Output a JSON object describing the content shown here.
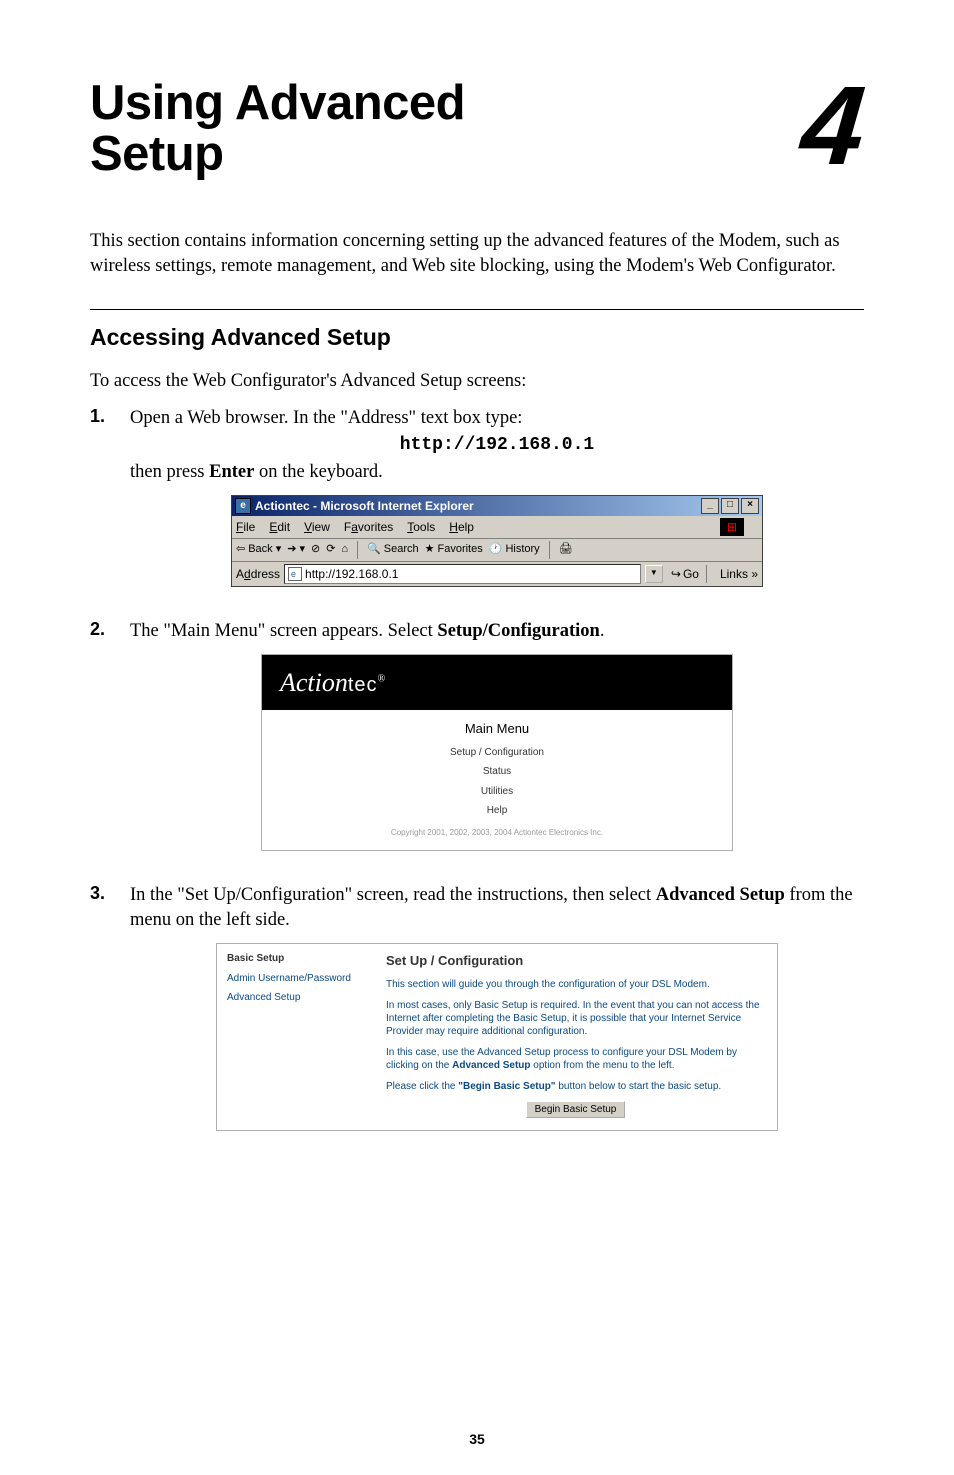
{
  "chapter": {
    "title_line1": "Using Advanced",
    "title_line2": "Setup",
    "number": "4"
  },
  "intro": "This section contains information concerning setting up the advanced features of the Modem, such as wireless settings, remote management, and Web site blocking, using the Modem's Web Configurator.",
  "section_heading": "Accessing Advanced Setup",
  "lead_text": "To access the Web Configurator's Advanced Setup screens:",
  "steps": {
    "s1": {
      "pre": "Open a Web browser. In the \"Address\" text box type:",
      "code": "http://192.168.0.1",
      "post_a": "then press ",
      "post_b": "Enter",
      "post_c": " on the keyboard."
    },
    "s2": {
      "a": "The \"Main Menu\" screen appears. Select ",
      "b": "Setup/Configuration",
      "c": "."
    },
    "s3": {
      "a": "In the \"Set Up/Configuration\" screen, read the instructions, then select ",
      "b": "Advanced Setup",
      "c": " from the menu on the left side."
    }
  },
  "ie": {
    "title": "Actiontec - Microsoft Internet Explorer",
    "min": "_",
    "max": "□",
    "close": "×",
    "menu": {
      "file": "File",
      "edit": "Edit",
      "view": "View",
      "fav": "Favorites",
      "tools": "Tools",
      "help": "Help"
    },
    "back": "Back",
    "search": "Search",
    "favorites": "Favorites",
    "history": "History",
    "addr_label": "Address",
    "url": "http://192.168.0.1",
    "go": "Go",
    "links": "Links",
    "arrow_down": "▾",
    "arrow_left": "⇦",
    "arrow_right": "➔",
    "stop": "⊘",
    "refresh": "⟳",
    "home": "⌂",
    "search_icon": "🔍",
    "fav_icon": "★",
    "hist_icon": "🕐",
    "print_icon": "🖨",
    "go_icon": "↪",
    "chev": "»"
  },
  "actiontec": {
    "logo_a": "Action",
    "logo_b": "tec",
    "reg": "®",
    "title": "Main Menu",
    "link1": "Setup / Configuration",
    "link2": "Status",
    "link3": "Utilities",
    "link4": "Help",
    "copy": "Copyright 2001, 2002, 2003, 2004 Actiontec Electronics Inc."
  },
  "cfg": {
    "side_head": "Basic Setup",
    "side1": "Admin Username/Password",
    "side2": "Advanced Setup",
    "title": "Set Up / Configuration",
    "p1": "This section will guide you through the configuration of your DSL Modem.",
    "p2": "In most cases, only Basic Setup is required. In the event that you can not access the Internet after completing the Basic Setup, it is possible that your Internet Service Provider may require additional configuration.",
    "p3a": "In this case, use the Advanced Setup process to configure your DSL Modem by clicking on the ",
    "p3b": "Advanced Setup",
    "p3c": " option from the menu to the left.",
    "p4a": "Please click the ",
    "p4b": "\"Begin Basic Setup\"",
    "p4c": " button below to start the basic setup.",
    "btn": "Begin Basic Setup"
  },
  "page_number": "35"
}
